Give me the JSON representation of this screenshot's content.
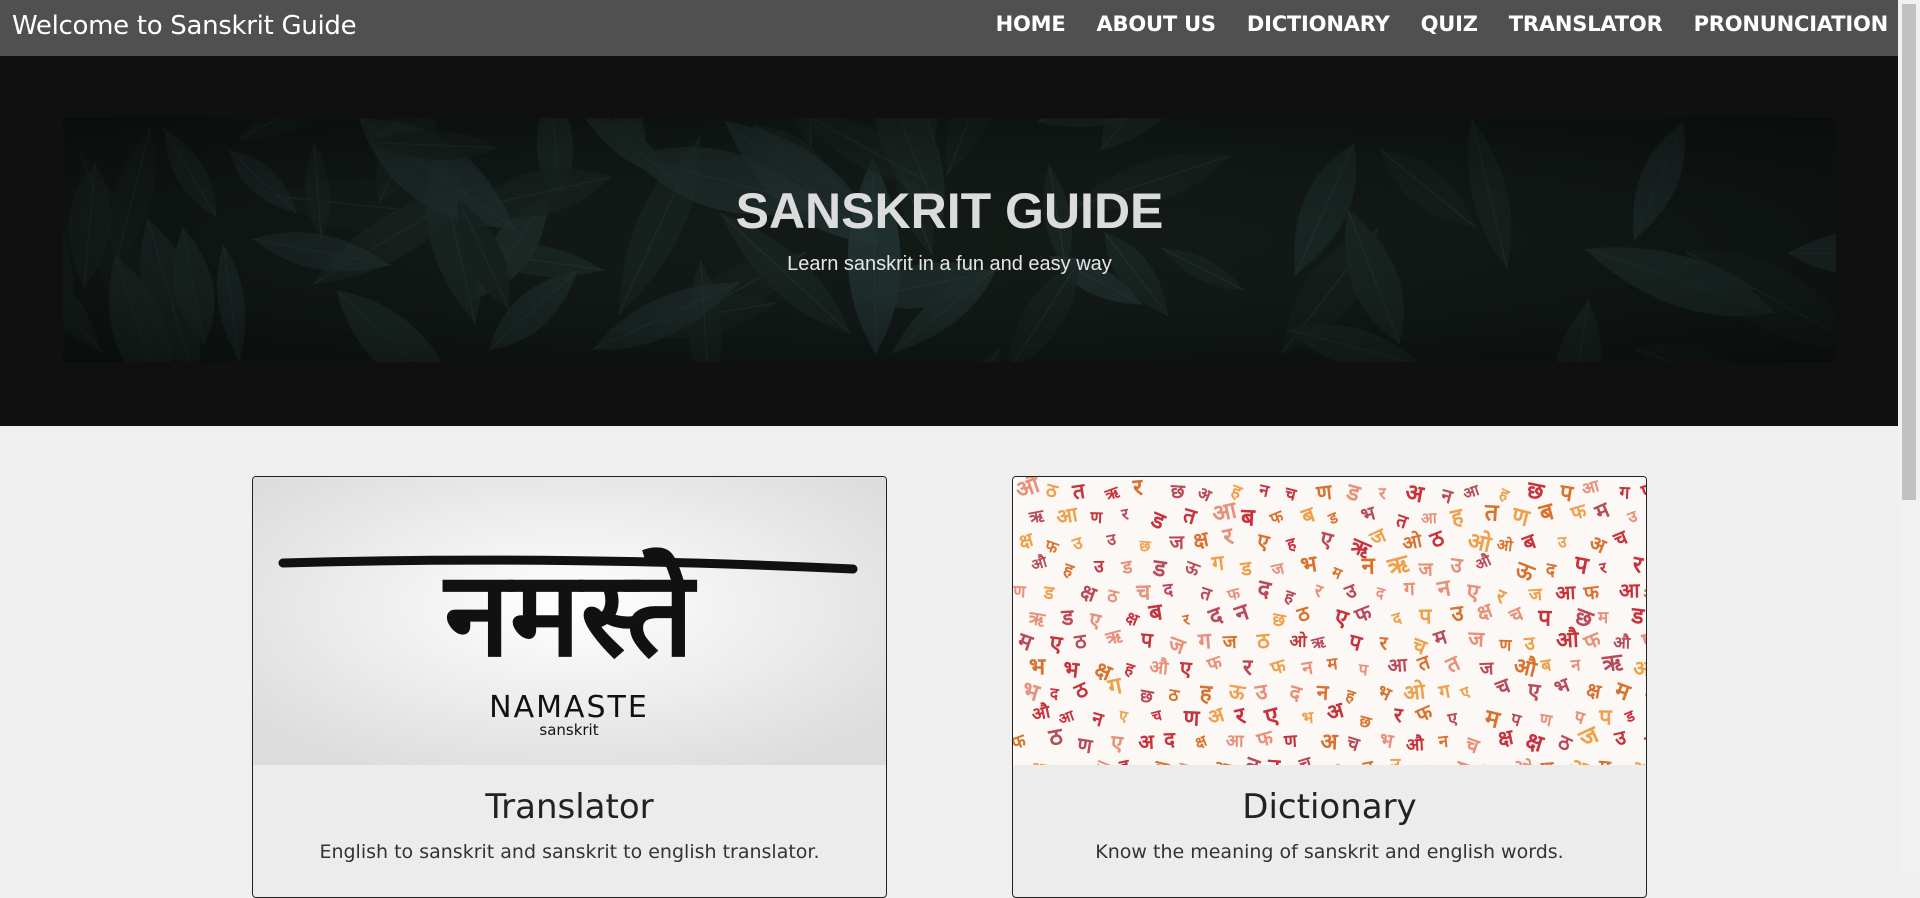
{
  "navbar": {
    "brand": "Welcome to Sanskrit Guide",
    "links": [
      "HOME",
      "ABOUT US",
      "DICTIONARY",
      "QUIZ",
      "TRANSLATOR",
      "PRONUNCIATION"
    ]
  },
  "hero": {
    "title": "SANSKRIT GUIDE",
    "subtitle": "Learn sanskrit in a fun and easy way"
  },
  "cards": [
    {
      "title": "Translator",
      "description": "English to sanskrit and sanskrit to english translator.",
      "image_text": {
        "devanagari": "नमस्ते",
        "latin": "NAMASTE",
        "caption": "sanskrit"
      }
    },
    {
      "title": "Dictionary",
      "description": "Know the meaning of sanskrit and english words.",
      "image_letters": [
        "अ",
        "आ",
        "ओ",
        "ऊ",
        "फ",
        "ब",
        "प",
        "त",
        "ग",
        "ण",
        "ज",
        "च",
        "ऋ",
        "छ",
        "म",
        "ह",
        "न",
        "ड",
        "क्ष",
        "उ",
        "र",
        "द",
        "ठ",
        "औ",
        "भ",
        "ए"
      ]
    }
  ],
  "colors": {
    "navbar": "#505050",
    "hero_bg": "#101010",
    "page_bg": "#efefef",
    "letter_red": "#c8323c",
    "letter_orange": "#f0a04a",
    "letter_peach": "#e8907a"
  }
}
